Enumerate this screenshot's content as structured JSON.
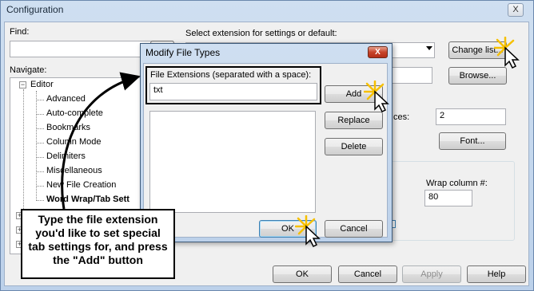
{
  "window": {
    "title": "Configuration",
    "close_glyph": "X"
  },
  "find": {
    "label": "Find:",
    "value": ""
  },
  "navigate": {
    "label": "Navigate:",
    "tree_root": "Editor",
    "tree_items": [
      "Advanced",
      "Auto-complete",
      "Bookmarks",
      "Column Mode",
      "Delimiters",
      "Miscellaneous",
      "New File Creation",
      "Word Wrap/Tab Sett"
    ]
  },
  "extension": {
    "label": "Select extension for settings or default:",
    "change_list_button": "Change list...",
    "browse_button": "Browse...",
    "spaces_label": "ces:",
    "spaces_value": "2",
    "font_button": "Font...",
    "wrap_column_label": "Wrap column #:",
    "wrap_column_value": "80"
  },
  "footer": {
    "ok_button": "OK",
    "cancel_button": "Cancel",
    "apply_button": "Apply",
    "help_button": "Help"
  },
  "dialog": {
    "title": "Modify File Types",
    "close_glyph": "X",
    "extensions_label": "File Extensions (separated with a space):",
    "extensions_value": "txt",
    "add_button": "Add",
    "replace_button": "Replace",
    "delete_button": "Delete",
    "ok_button": "OK",
    "cancel_button": "Cancel"
  },
  "callout": {
    "text": "Type the file extension you'd like to set special tab settings for, and press the \"Add\" button"
  },
  "colors": {
    "title_bar": "#c4d7ee",
    "highlight_border": "#000000",
    "cursor_glow": "#f6c000"
  },
  "icons": [
    "close-icon",
    "dropdown-arrow-icon",
    "tree-expand-icon",
    "pointer-cursor-icon"
  ]
}
